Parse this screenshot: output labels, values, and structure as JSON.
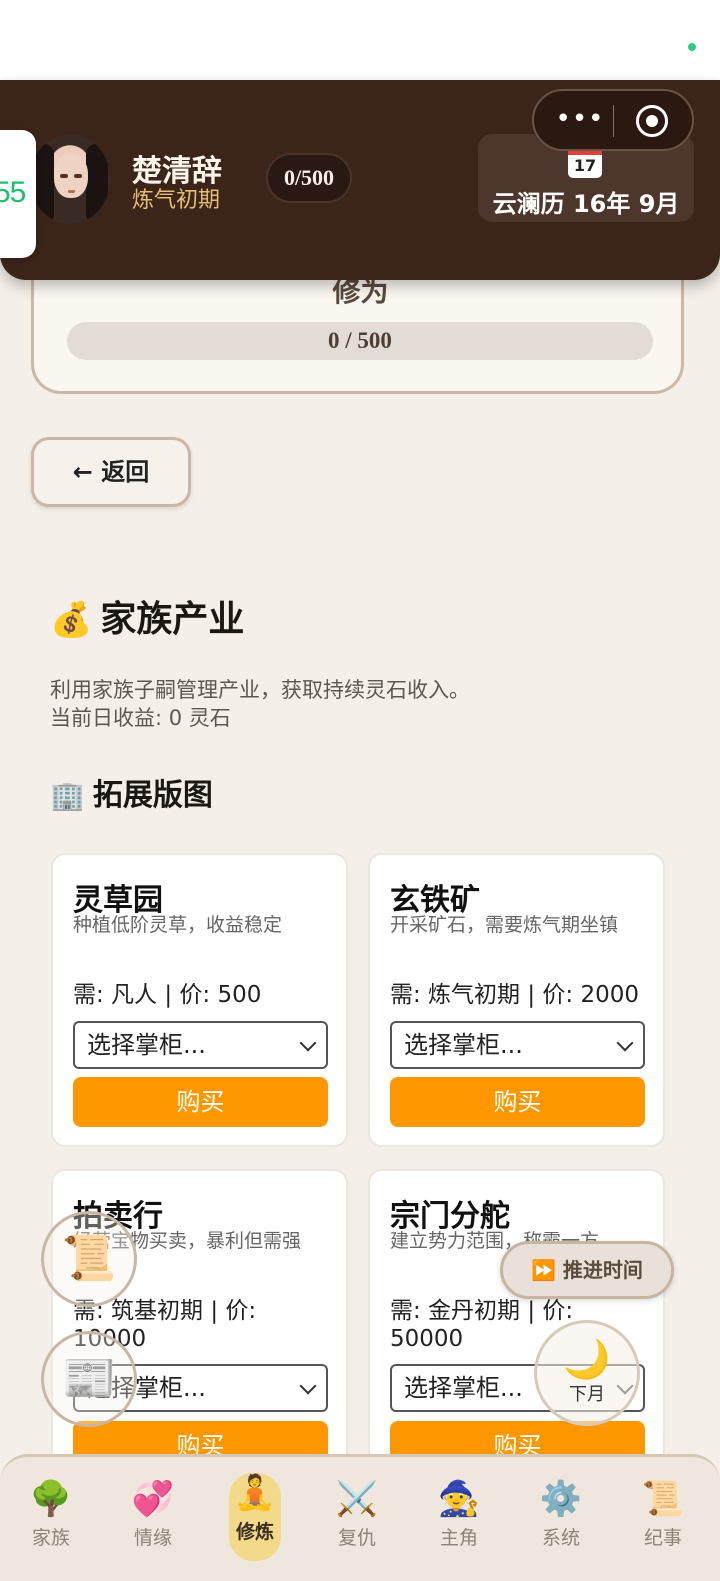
{
  "header": {
    "side_badge": "55",
    "character_name": "楚清辞",
    "realm": "炼气初期",
    "exp": "0/500",
    "calendar_month": "July",
    "calendar_day": "17",
    "date": "云澜历 16年 9月",
    "menu_dots": "•••"
  },
  "cultivation": {
    "title": "修为",
    "progress_text": "0 / 500",
    "progress_fraction": 0
  },
  "back_label": "← 返回",
  "section": {
    "emoji": "💰",
    "title": "家族产业",
    "desc_line1": "利用家族子嗣管理产业，获取持续灵石收入。",
    "desc_line2": "当前日收益: 0 灵石",
    "sub_emoji": "🏢",
    "sub_title": "拓展版图"
  },
  "cards": [
    {
      "name": "灵草园",
      "desc": "种植低阶灵草，收益稳定",
      "req": "需: 凡人 | 价: 500",
      "select": "选择掌柜...",
      "buy": "购买"
    },
    {
      "name": "玄铁矿",
      "desc": "开采矿石，需要炼气期坐镇",
      "req": "需: 炼气初期 | 价: 2000",
      "select": "选择掌柜...",
      "buy": "购买"
    },
    {
      "name": "拍卖行",
      "desc": "经营宝物买卖，暴利但需强",
      "req": "需: 筑基初期 | 价: 10000",
      "select": "选择掌柜...",
      "buy": "购买"
    },
    {
      "name": "宗门分舵",
      "desc": "建立势力范围，称霸一方",
      "req": "需: 金丹初期 | 价: 50000",
      "select": "选择掌柜...",
      "buy": "购买"
    }
  ],
  "floating": {
    "scroll_icon": "📜",
    "news_icon": "📰",
    "advance_time": "⏩ 推进时间",
    "moon_icon": "🌙",
    "next_month": "下月"
  },
  "tabs": [
    {
      "icon": "🌳",
      "label": "家族"
    },
    {
      "icon": "💞",
      "label": "情缘"
    },
    {
      "icon": "🧘",
      "label": "修炼"
    },
    {
      "icon": "⚔️",
      "label": "复仇"
    },
    {
      "icon": "🧙",
      "label": "主角"
    },
    {
      "icon": "⚙️",
      "label": "系统"
    },
    {
      "icon": "📜",
      "label": "纪事"
    }
  ]
}
